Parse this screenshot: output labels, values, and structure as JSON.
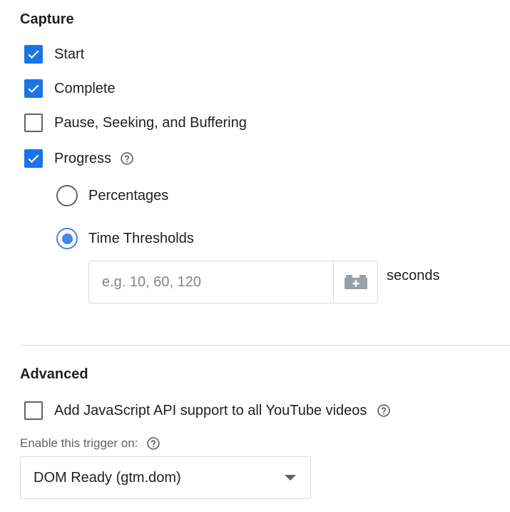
{
  "capture": {
    "title": "Capture",
    "options": [
      {
        "label": "Start",
        "checked": true
      },
      {
        "label": "Complete",
        "checked": true
      },
      {
        "label": "Pause, Seeking, and Buffering",
        "checked": false
      },
      {
        "label": "Progress",
        "checked": true
      }
    ],
    "progress_modes": [
      {
        "label": "Percentages",
        "selected": false
      },
      {
        "label": "Time Thresholds",
        "selected": true
      }
    ],
    "thresholds": {
      "value": "",
      "placeholder": "e.g. 10, 60, 120",
      "unit": "seconds"
    }
  },
  "advanced": {
    "title": "Advanced",
    "js_api": {
      "label": "Add JavaScript API support to all YouTube videos",
      "checked": false
    },
    "enable_on": {
      "label": "Enable this trigger on:",
      "selected": "DOM Ready (gtm.dom)"
    }
  },
  "colors": {
    "accent": "#1a73e8",
    "radio_accent": "#4285f4",
    "border": "#dadce0",
    "text": "#202124",
    "secondary_text": "#5f6368"
  },
  "icons": {
    "check": "check-icon",
    "help": "help-icon",
    "variable": "variable-icon",
    "dropdown": "dropdown-arrow-icon"
  }
}
